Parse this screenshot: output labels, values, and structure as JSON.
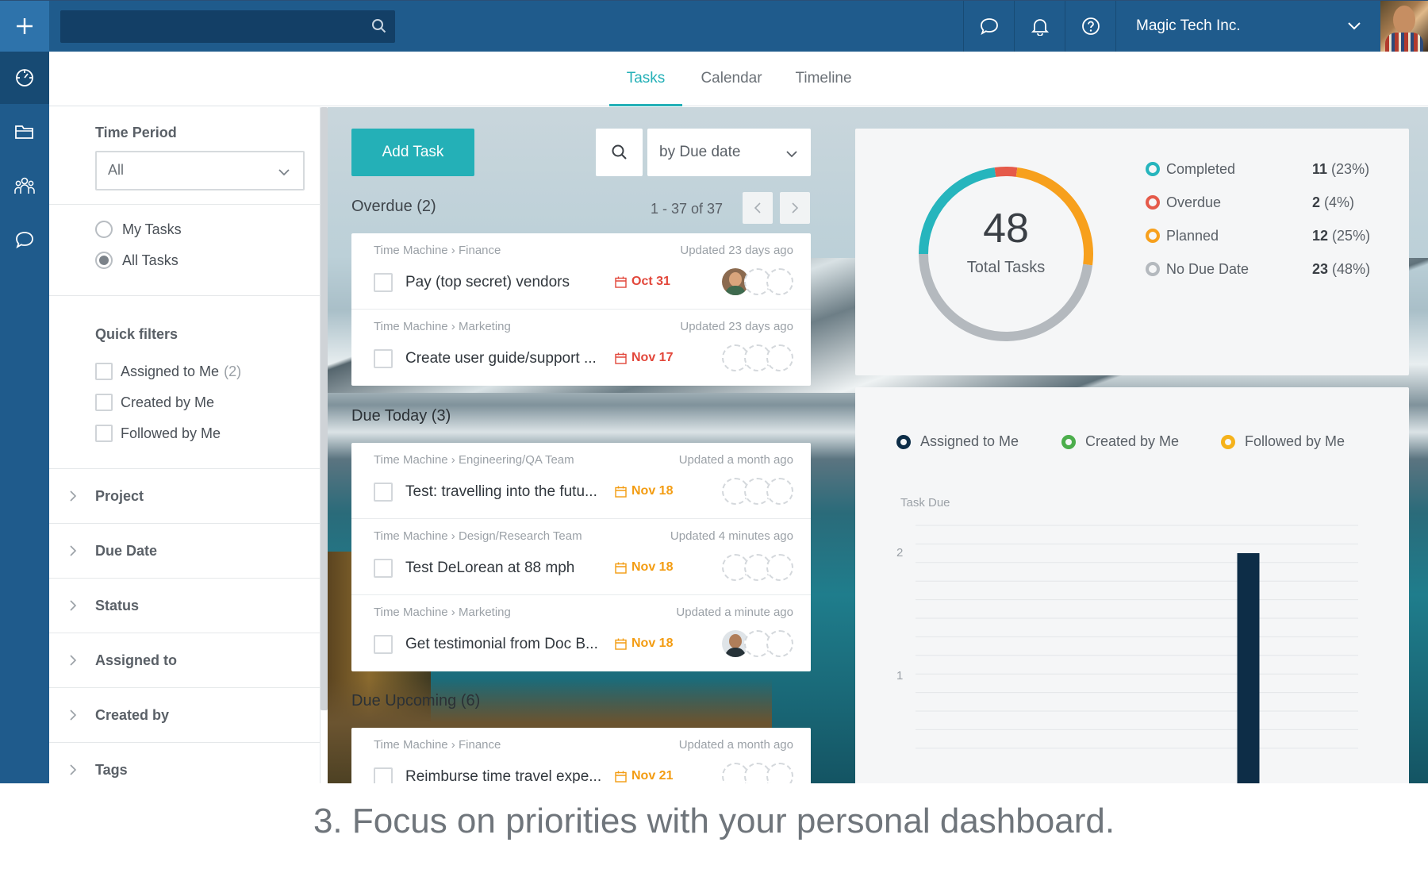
{
  "topbar": {
    "org_name": "Magic Tech Inc.",
    "search_placeholder": ""
  },
  "tabs": [
    {
      "label": "Tasks",
      "active": true
    },
    {
      "label": "Calendar",
      "active": false
    },
    {
      "label": "Timeline",
      "active": false
    }
  ],
  "filters": {
    "time_period_label": "Time Period",
    "time_period_value": "All",
    "radio": [
      {
        "label": "My Tasks",
        "checked": false
      },
      {
        "label": "All Tasks",
        "checked": true
      }
    ],
    "quick_filters_label": "Quick filters",
    "quick": [
      {
        "label": "Assigned to Me",
        "count": "(2)"
      },
      {
        "label": "Created by Me",
        "count": ""
      },
      {
        "label": "Followed by Me",
        "count": ""
      }
    ],
    "sections": [
      "Project",
      "Due Date",
      "Status",
      "Assigned to",
      "Created by",
      "Tags"
    ]
  },
  "tasks": {
    "add_label": "Add Task",
    "sort_value": "by Due date",
    "pager": "1 - 37 of 37",
    "groups": [
      {
        "title": "Overdue (2)",
        "items": [
          {
            "project": "Time Machine",
            "team": "Finance",
            "updated": "Updated 23 days ago",
            "title": "Pay (top secret) vendors",
            "due": "Oct 31",
            "due_color": "#e2463a",
            "avatar": "photo-a"
          },
          {
            "project": "Time Machine",
            "team": "Marketing",
            "updated": "Updated 23 days ago",
            "title": "Create user guide/support ...",
            "due": "Nov 17",
            "due_color": "#e2463a",
            "avatar": ""
          }
        ]
      },
      {
        "title": "Due Today (3)",
        "items": [
          {
            "project": "Time Machine",
            "team": "Engineering/QA Team",
            "updated": "Updated a month ago",
            "title": "Test: travelling into the futu...",
            "due": "Nov 18",
            "due_color": "#f39c12",
            "avatar": ""
          },
          {
            "project": "Time Machine",
            "team": "Design/Research Team",
            "updated": "Updated 4 minutes ago",
            "title": "Test DeLorean at 88 mph",
            "due": "Nov 18",
            "due_color": "#f39c12",
            "avatar": ""
          },
          {
            "project": "Time Machine",
            "team": "Marketing",
            "updated": "Updated a minute ago",
            "title": "Get testimonial from Doc B...",
            "due": "Nov 18",
            "due_color": "#f39c12",
            "avatar": "photo-b"
          }
        ]
      },
      {
        "title": "Due Upcoming (6)",
        "items": [
          {
            "project": "Time Machine",
            "team": "Finance",
            "updated": "Updated a month ago",
            "title": "Reimburse time travel expe...",
            "due": "Nov 21",
            "due_color": "#f39c12",
            "avatar": ""
          }
        ]
      }
    ]
  },
  "summary": {
    "total": "48",
    "total_label": "Total Tasks",
    "rows": [
      {
        "label": "Completed",
        "count": "11",
        "pct": "(23%)",
        "value": 11,
        "color": "#26b5bd"
      },
      {
        "label": "Overdue",
        "count": "2",
        "pct": "(4%)",
        "value": 2,
        "color": "#e55a4a"
      },
      {
        "label": "Planned",
        "count": "12",
        "pct": "(25%)",
        "value": 12,
        "color": "#f7a01d"
      },
      {
        "label": "No Due Date",
        "count": "23",
        "pct": "(48%)",
        "value": 23,
        "color": "#b4b9be"
      }
    ]
  },
  "chart_data": {
    "type": "bar",
    "title": "",
    "ylabel": "Task Due",
    "xlabel": "",
    "ylim": [
      0,
      2
    ],
    "yticks": [
      "1",
      "2"
    ],
    "legend": [
      {
        "name": "Assigned to Me",
        "color": "#0d2d47"
      },
      {
        "name": "Created by Me",
        "color": "#4cae4c"
      },
      {
        "name": "Followed by Me",
        "color": "#f5b21b"
      }
    ],
    "series": [
      {
        "name": "Assigned to Me",
        "color": "#0d2d47",
        "values": [
          0,
          0,
          0,
          0,
          0,
          0,
          0,
          2,
          0,
          0
        ]
      }
    ]
  },
  "caption": "3. Focus on priorities with your personal dashboard."
}
